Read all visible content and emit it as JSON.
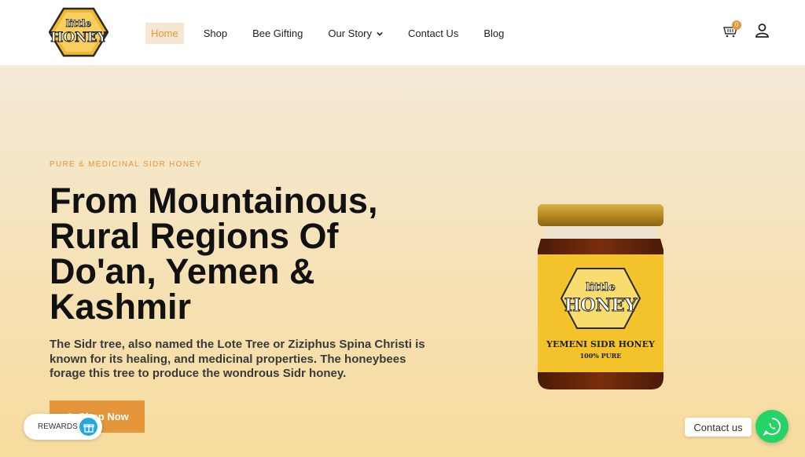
{
  "brand": {
    "logo_text_top": "little",
    "logo_text_bottom": "HONEY"
  },
  "nav": {
    "items": [
      {
        "label": "Home",
        "active": true
      },
      {
        "label": "Shop"
      },
      {
        "label": "Bee Gifting"
      },
      {
        "label": "Our Story",
        "dropdown": true
      },
      {
        "label": "Contact Us"
      },
      {
        "label": "Blog"
      }
    ]
  },
  "cart": {
    "count": "0",
    "icon": "cart-icon"
  },
  "account": {
    "icon": "user-icon"
  },
  "hero": {
    "eyebrow": "PURE & MEDICINAL SIDR HONEY",
    "headline_lines": [
      "From Mountainous,",
      "Rural Regions Of",
      "Do'an, Yemen &",
      "Kashmir"
    ],
    "description": "The Sidr tree, also named the Lote Tree or Ziziphus Spina Christi is known for its healing, and medicinal properties. The honeybees forage this tree to produce the wondrous Sidr honey.",
    "cta_label": "Shop Now"
  },
  "product_jar": {
    "logo_top": "little",
    "logo_bottom": "HONEY",
    "label_title": "YEMENI SIDR HONEY",
    "label_sub": "100% PURE"
  },
  "widgets": {
    "rewards_label": "REWARDS",
    "contact_label": "Contact us"
  },
  "colors": {
    "accent": "#e5963a",
    "whatsapp": "#25d366",
    "rewards": "#2aa5e0"
  }
}
